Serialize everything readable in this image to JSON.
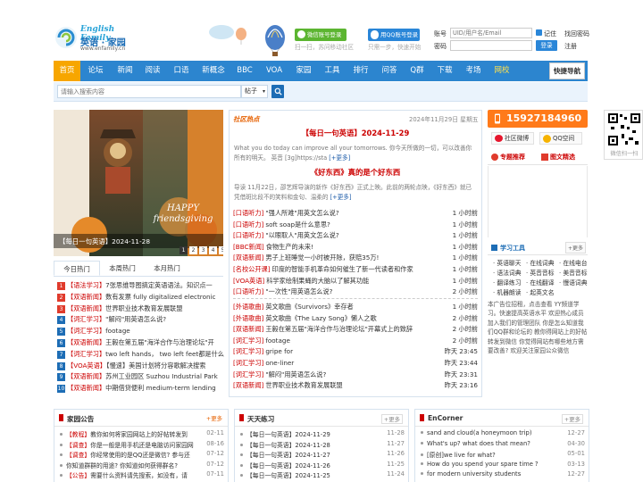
{
  "header": {
    "logo_en": "English Family",
    "logo_cn": "英语 · 家园",
    "logo_url": "www.enfamily.cn",
    "wechat_btn": "微信账号登录",
    "wechat_sub": "扫一扫，苏问移动社区",
    "qq_btn": "用QQ账号登录",
    "qq_sub": "只需一步，快速开始",
    "login": {
      "account_label": "账号",
      "account_placeholder": "UID/用户名/Email",
      "remember": "记住",
      "find_pwd": "找回密码",
      "pwd_label": "密码",
      "login_btn": "登录",
      "register": "注册"
    }
  },
  "nav": {
    "items": [
      "首页",
      "论坛",
      "新闻",
      "阅读",
      "口语",
      "新概念",
      "BBC",
      "VOA",
      "家园",
      "工具",
      "排行",
      "问答",
      "Q群",
      "下载",
      "考场",
      "网校"
    ],
    "quick": "快捷导航"
  },
  "search": {
    "placeholder": "请输入搜索内容",
    "type": "帖子"
  },
  "slider": {
    "caption": "【每日一句英语】2024-11-28",
    "pages": [
      "1",
      "2",
      "3",
      "4",
      "5"
    ],
    "art_text": "HAPPY friendsgiving"
  },
  "hot_tabs": [
    "今日热门",
    "本周热门",
    "本月热门"
  ],
  "hot_list": [
    {
      "num": "1",
      "tag": "【语法学习】",
      "title": "7张思维导图搞定英语语法。知识点一"
    },
    {
      "num": "2",
      "tag": "【双语新闻】",
      "title": "数有发票 fully digitalized electronic"
    },
    {
      "num": "3",
      "tag": "【双语新闻】",
      "title": "世界职业技术教育发展联盟"
    },
    {
      "num": "4",
      "tag": "【词汇学习】",
      "title": "\"解闷\"用英语怎么说?"
    },
    {
      "num": "5",
      "tag": "【词汇学习】",
      "title": "footage"
    },
    {
      "num": "6",
      "tag": "【双语新闻】",
      "title": "王毅在第五届\"海洋合作与治理论坛\"开"
    },
    {
      "num": "7",
      "tag": "【词汇学习】",
      "title": "two left hands， two left feet都是什么"
    },
    {
      "num": "8",
      "tag": "【VOA英语】",
      "title": "【慢速】美国计划将分容歌解决搜索"
    },
    {
      "num": "9",
      "tag": "【双语新闻】",
      "title": "苏州工业园区 Suzhou Industrial Park"
    },
    {
      "num": "10",
      "tag": "【双语新闻】",
      "title": "中期借贷便利 medium-term lending"
    }
  ],
  "center": {
    "section": "社区热点",
    "date": "2024年11月29日 星期五",
    "feature1": {
      "title": "【每日一句英语】2024-11-29",
      "desc": "What you do today can improve all your tomorrows. 你今天所做的一切，可以改善你所有的明天。 英音 [3g]https://sta",
      "more": "[+更多]"
    },
    "feature2": {
      "title": "《好东西》真的是个好东西",
      "desc": "导读 11月22日，邵艺辉导演的新作《好东西》正式上映。此前的两轮点映，《好东西》就已凭借斑比段不的笑料和金句、温柔的",
      "more": "[+更多]"
    },
    "list1": [
      {
        "tag": "[口语听力]",
        "title": "\"强人所难\"用英文怎么说?",
        "time": "1 小时前"
      },
      {
        "tag": "[口语听力]",
        "title": "soft soap是什么意思?",
        "time": "1 小时前"
      },
      {
        "tag": "[口语听力]",
        "title": "\"以眼取人\"用英文怎么说?",
        "time": "1 小时前"
      },
      {
        "tag": "[BBC新闻]",
        "title": "食物生产的未来!",
        "time": "1 小时前"
      },
      {
        "tag": "[双语新闻]",
        "title": "男子上班睡觉一小时被开除，获赔35万!",
        "time": "1 小时前"
      },
      {
        "tag": "[名校公开课]",
        "title": "印度的智能手机革命如何催生了新一代读者和作家",
        "time": "1 小时前"
      },
      {
        "tag": "[VOA英语]",
        "title": "科学家绘制果蝇的大脑以了解其功能",
        "time": "1 小时前"
      },
      {
        "tag": "[口语听力]",
        "title": "\"一次性\"用英语怎么说?",
        "time": "2 小时前"
      }
    ],
    "list2": [
      {
        "tag": "[外语歌曲]",
        "title": "英文歌曲《Survivors》幸存者",
        "time": "1 小时前"
      },
      {
        "tag": "[外语歌曲]",
        "title": "英文歌曲《The Lazy Song》懒人之歌",
        "time": "2 小时前"
      },
      {
        "tag": "[双语新闻]",
        "title": "王毅在第五届\"海洋合作与治理论坛\"开幕式上的致辞",
        "time": "2 小时前"
      },
      {
        "tag": "[词汇学习]",
        "title": "footage",
        "time": "2 小时前"
      },
      {
        "tag": "[词汇学习]",
        "title": "gripe for",
        "time": "昨天 23:45"
      },
      {
        "tag": "[词汇学习]",
        "title": "one-liner",
        "time": "昨天 23:44"
      },
      {
        "tag": "[词汇学习]",
        "title": "\"解闷\"用英语怎么说?",
        "time": "昨天 23:31"
      },
      {
        "tag": "[双语新闻]",
        "title": "世界职业技术教育发展联盟",
        "time": "昨天 23:16"
      }
    ]
  },
  "sidebar": {
    "phone": "15927184960",
    "weibo": "社区微博",
    "qzone": "QQ空间",
    "qr_caption": "微信扫一扫",
    "tab1": "专题推荐",
    "tab2": "图文精选",
    "tools_title": "学习工具",
    "tools_more": "+更多",
    "tools": [
      "英语聊天",
      "在线词典",
      "在线电台",
      "语法词典",
      "英音音标",
      "美音音标",
      "翻译练习",
      "在线翻译",
      "慢语词典",
      "机器朗读",
      "起英文名"
    ],
    "notice": "本广告位招租，点击查看 YY频道学习。快速提高英语水平 欢迎热心成员加入我们的管理团队 你是怎么知道我们QQ群和论坛的 教你得网站上的好帖转发到微信 你觉得网站有哪些地方需要改善? 欢迎关注家园公众微信"
  },
  "bottom": {
    "notice": {
      "title": "家园公告",
      "more": "+更多",
      "items": [
        {
          "tag": "【教程】",
          "title": "教你如何将家园网站上的好帖转发到",
          "date": "02-11"
        },
        {
          "tag": "【调查】",
          "title": "你是一般是用手机还是电脑访问家园网",
          "date": "08-16"
        },
        {
          "tag": "【调查】",
          "title": "你经常使用的是QQ还是微信? 参与还",
          "date": "07-12"
        },
        {
          "tag": "",
          "title": "你知道群群的用途? 你知道如何获得群名?",
          "date": "07-12"
        },
        {
          "tag": "【公告】",
          "title": "需要什么资料请先搜索，如没有，请",
          "date": "07-11"
        }
      ]
    },
    "daily": {
      "title": "天天练习",
      "more": "+更多",
      "items": [
        {
          "title": "【每日一句英语】2024-11-29",
          "date": "11-28"
        },
        {
          "title": "【每日一句英语】2024-11-28",
          "date": "11-27"
        },
        {
          "title": "【每日一句英语】2024-11-27",
          "date": "11-26"
        },
        {
          "title": "【每日一句英语】2024-11-26",
          "date": "11-25"
        },
        {
          "title": "【每日一句英语】2024-11-25",
          "date": "11-24"
        }
      ]
    },
    "encorner": {
      "title": "EnCorner",
      "more": "+更多",
      "items": [
        {
          "title": "sand and cloud(a honeymoon trip)",
          "date": "12-27"
        },
        {
          "title": "What's up? what does that mean?",
          "date": "04-30"
        },
        {
          "title": "[原创]we live for what?",
          "date": "05-01"
        },
        {
          "title": "How do you spend your spare time ?",
          "date": "03-13"
        },
        {
          "title": "for modern university students",
          "date": "12-27"
        }
      ]
    }
  }
}
